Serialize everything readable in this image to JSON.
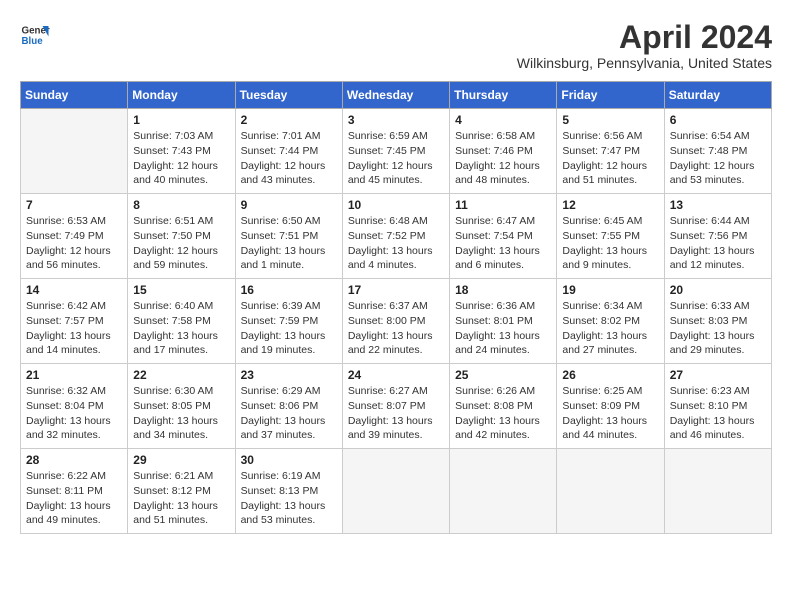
{
  "header": {
    "logo_general": "General",
    "logo_blue": "Blue",
    "month_title": "April 2024",
    "location": "Wilkinsburg, Pennsylvania, United States"
  },
  "days_of_week": [
    "Sunday",
    "Monday",
    "Tuesday",
    "Wednesday",
    "Thursday",
    "Friday",
    "Saturday"
  ],
  "weeks": [
    [
      {
        "day": "",
        "empty": true
      },
      {
        "day": "1",
        "sunrise": "Sunrise: 7:03 AM",
        "sunset": "Sunset: 7:43 PM",
        "daylight": "Daylight: 12 hours and 40 minutes."
      },
      {
        "day": "2",
        "sunrise": "Sunrise: 7:01 AM",
        "sunset": "Sunset: 7:44 PM",
        "daylight": "Daylight: 12 hours and 43 minutes."
      },
      {
        "day": "3",
        "sunrise": "Sunrise: 6:59 AM",
        "sunset": "Sunset: 7:45 PM",
        "daylight": "Daylight: 12 hours and 45 minutes."
      },
      {
        "day": "4",
        "sunrise": "Sunrise: 6:58 AM",
        "sunset": "Sunset: 7:46 PM",
        "daylight": "Daylight: 12 hours and 48 minutes."
      },
      {
        "day": "5",
        "sunrise": "Sunrise: 6:56 AM",
        "sunset": "Sunset: 7:47 PM",
        "daylight": "Daylight: 12 hours and 51 minutes."
      },
      {
        "day": "6",
        "sunrise": "Sunrise: 6:54 AM",
        "sunset": "Sunset: 7:48 PM",
        "daylight": "Daylight: 12 hours and 53 minutes."
      }
    ],
    [
      {
        "day": "7",
        "sunrise": "Sunrise: 6:53 AM",
        "sunset": "Sunset: 7:49 PM",
        "daylight": "Daylight: 12 hours and 56 minutes."
      },
      {
        "day": "8",
        "sunrise": "Sunrise: 6:51 AM",
        "sunset": "Sunset: 7:50 PM",
        "daylight": "Daylight: 12 hours and 59 minutes."
      },
      {
        "day": "9",
        "sunrise": "Sunrise: 6:50 AM",
        "sunset": "Sunset: 7:51 PM",
        "daylight": "Daylight: 13 hours and 1 minute."
      },
      {
        "day": "10",
        "sunrise": "Sunrise: 6:48 AM",
        "sunset": "Sunset: 7:52 PM",
        "daylight": "Daylight: 13 hours and 4 minutes."
      },
      {
        "day": "11",
        "sunrise": "Sunrise: 6:47 AM",
        "sunset": "Sunset: 7:54 PM",
        "daylight": "Daylight: 13 hours and 6 minutes."
      },
      {
        "day": "12",
        "sunrise": "Sunrise: 6:45 AM",
        "sunset": "Sunset: 7:55 PM",
        "daylight": "Daylight: 13 hours and 9 minutes."
      },
      {
        "day": "13",
        "sunrise": "Sunrise: 6:44 AM",
        "sunset": "Sunset: 7:56 PM",
        "daylight": "Daylight: 13 hours and 12 minutes."
      }
    ],
    [
      {
        "day": "14",
        "sunrise": "Sunrise: 6:42 AM",
        "sunset": "Sunset: 7:57 PM",
        "daylight": "Daylight: 13 hours and 14 minutes."
      },
      {
        "day": "15",
        "sunrise": "Sunrise: 6:40 AM",
        "sunset": "Sunset: 7:58 PM",
        "daylight": "Daylight: 13 hours and 17 minutes."
      },
      {
        "day": "16",
        "sunrise": "Sunrise: 6:39 AM",
        "sunset": "Sunset: 7:59 PM",
        "daylight": "Daylight: 13 hours and 19 minutes."
      },
      {
        "day": "17",
        "sunrise": "Sunrise: 6:37 AM",
        "sunset": "Sunset: 8:00 PM",
        "daylight": "Daylight: 13 hours and 22 minutes."
      },
      {
        "day": "18",
        "sunrise": "Sunrise: 6:36 AM",
        "sunset": "Sunset: 8:01 PM",
        "daylight": "Daylight: 13 hours and 24 minutes."
      },
      {
        "day": "19",
        "sunrise": "Sunrise: 6:34 AM",
        "sunset": "Sunset: 8:02 PM",
        "daylight": "Daylight: 13 hours and 27 minutes."
      },
      {
        "day": "20",
        "sunrise": "Sunrise: 6:33 AM",
        "sunset": "Sunset: 8:03 PM",
        "daylight": "Daylight: 13 hours and 29 minutes."
      }
    ],
    [
      {
        "day": "21",
        "sunrise": "Sunrise: 6:32 AM",
        "sunset": "Sunset: 8:04 PM",
        "daylight": "Daylight: 13 hours and 32 minutes."
      },
      {
        "day": "22",
        "sunrise": "Sunrise: 6:30 AM",
        "sunset": "Sunset: 8:05 PM",
        "daylight": "Daylight: 13 hours and 34 minutes."
      },
      {
        "day": "23",
        "sunrise": "Sunrise: 6:29 AM",
        "sunset": "Sunset: 8:06 PM",
        "daylight": "Daylight: 13 hours and 37 minutes."
      },
      {
        "day": "24",
        "sunrise": "Sunrise: 6:27 AM",
        "sunset": "Sunset: 8:07 PM",
        "daylight": "Daylight: 13 hours and 39 minutes."
      },
      {
        "day": "25",
        "sunrise": "Sunrise: 6:26 AM",
        "sunset": "Sunset: 8:08 PM",
        "daylight": "Daylight: 13 hours and 42 minutes."
      },
      {
        "day": "26",
        "sunrise": "Sunrise: 6:25 AM",
        "sunset": "Sunset: 8:09 PM",
        "daylight": "Daylight: 13 hours and 44 minutes."
      },
      {
        "day": "27",
        "sunrise": "Sunrise: 6:23 AM",
        "sunset": "Sunset: 8:10 PM",
        "daylight": "Daylight: 13 hours and 46 minutes."
      }
    ],
    [
      {
        "day": "28",
        "sunrise": "Sunrise: 6:22 AM",
        "sunset": "Sunset: 8:11 PM",
        "daylight": "Daylight: 13 hours and 49 minutes."
      },
      {
        "day": "29",
        "sunrise": "Sunrise: 6:21 AM",
        "sunset": "Sunset: 8:12 PM",
        "daylight": "Daylight: 13 hours and 51 minutes."
      },
      {
        "day": "30",
        "sunrise": "Sunrise: 6:19 AM",
        "sunset": "Sunset: 8:13 PM",
        "daylight": "Daylight: 13 hours and 53 minutes."
      },
      {
        "day": "",
        "empty": true
      },
      {
        "day": "",
        "empty": true
      },
      {
        "day": "",
        "empty": true
      },
      {
        "day": "",
        "empty": true
      }
    ]
  ]
}
